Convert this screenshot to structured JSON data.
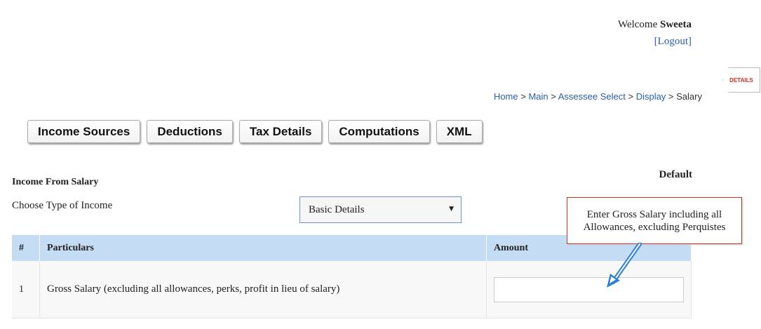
{
  "header": {
    "welcome_prefix": "Welcome",
    "user_name": "Sweeta",
    "logout_label": "[Logout]",
    "details_tab": "DETAILS"
  },
  "breadcrumb": {
    "home": "Home",
    "sep1": " > ",
    "main": "Main",
    "sep2": " > ",
    "assessee_select": "Assessee Select",
    "sep3": " > ",
    "display": "Display",
    "sep4": " > ",
    "current": "Salary"
  },
  "tabs": [
    "Income Sources",
    "Deductions",
    "Tax Details",
    "Computations",
    "XML"
  ],
  "form": {
    "default_label": "Default",
    "section_title": "Income From Salary",
    "type_label": "Choose Type of Income",
    "type_selected": "Basic Details"
  },
  "table": {
    "headers": {
      "num": "#",
      "particulars": "Particulars",
      "amount": "Amount"
    },
    "rows": [
      {
        "num": "1",
        "particular": "Gross Salary (excluding all allowances, perks, profit in lieu of salary)",
        "amount": ""
      }
    ]
  },
  "callout": {
    "text": "Enter Gross Salary including all Allowances, excluding Perquistes"
  },
  "colors": {
    "link": "#2a5db0",
    "header_bg": "#c5dcf5",
    "callout_border": "#d9321e",
    "arrow": "#2b7fd8"
  }
}
